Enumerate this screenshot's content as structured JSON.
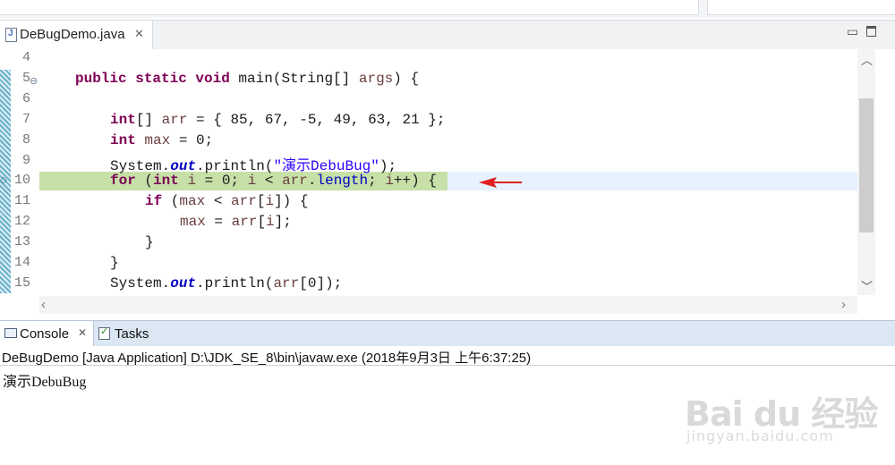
{
  "editor": {
    "tab_label": "DeBugDemo.java",
    "close_glyph": "✕",
    "lines": [
      {
        "num": "4"
      },
      {
        "num": "5"
      },
      {
        "num": "6"
      },
      {
        "num": "7"
      },
      {
        "num": "8"
      },
      {
        "num": "9"
      },
      {
        "num": "10"
      },
      {
        "num": "11"
      },
      {
        "num": "12"
      },
      {
        "num": "13"
      },
      {
        "num": "14"
      },
      {
        "num": "15"
      }
    ],
    "code": {
      "l5_kw": "public static void",
      "l5_rest": " main(String[] ",
      "l5_var": "args",
      "l5_end": ") {",
      "l7_kw": "int",
      "l7_a": "[] ",
      "l7_var": "arr",
      "l7_b": " = { 85, 67, -5, 49, 63, 21 };",
      "l8_kw": "int",
      "l8_sp": " ",
      "l8_var": "max",
      "l8_b": " = 0;",
      "l9_a": "System.",
      "l9_fld": "out",
      "l9_b": ".println(",
      "l9_str": "\"演示DebuBug\"",
      "l9_c": ");",
      "l10_kw": "for",
      "l10_a": " (",
      "l10_kw2": "int",
      "l10_sp": " ",
      "l10_var1": "i",
      "l10_b": " = 0; ",
      "l10_var2": "i",
      "l10_c": " < ",
      "l10_var3": "arr",
      "l10_d": ".",
      "l10_fld": "length",
      "l10_e": "; ",
      "l10_var4": "i",
      "l10_f": "++) {",
      "l11_kw": "if",
      "l11_a": " (",
      "l11_var1": "max",
      "l11_b": " < ",
      "l11_var2": "arr",
      "l11_c": "[",
      "l11_var3": "i",
      "l11_d": "]) {",
      "l12_var1": "max",
      "l12_a": " = ",
      "l12_var2": "arr",
      "l12_b": "[",
      "l12_var3": "i",
      "l12_c": "];",
      "l13": "}",
      "l14": "}",
      "l15_a": "System.",
      "l15_fld": "out",
      "l15_b": ".println(",
      "l15_var": "arr",
      "l15_c": "[0]);"
    }
  },
  "console": {
    "tab_label": "Console",
    "tab_close": "✕",
    "tasks_label": "Tasks",
    "header": "DeBugDemo [Java Application] D:\\JDK_SE_8\\bin\\javaw.exe (2018年9月3日 上午6:37:25)",
    "output": "演示DebuBug"
  },
  "watermark": {
    "brand": "Bai du 经验",
    "url": "jingyan.baidu.com"
  },
  "colors": {
    "keyword": "#7f0055",
    "string": "#2a00ff",
    "field": "#0000c0",
    "debug_line": "#c6e0a8",
    "arrow": "#e02020"
  }
}
